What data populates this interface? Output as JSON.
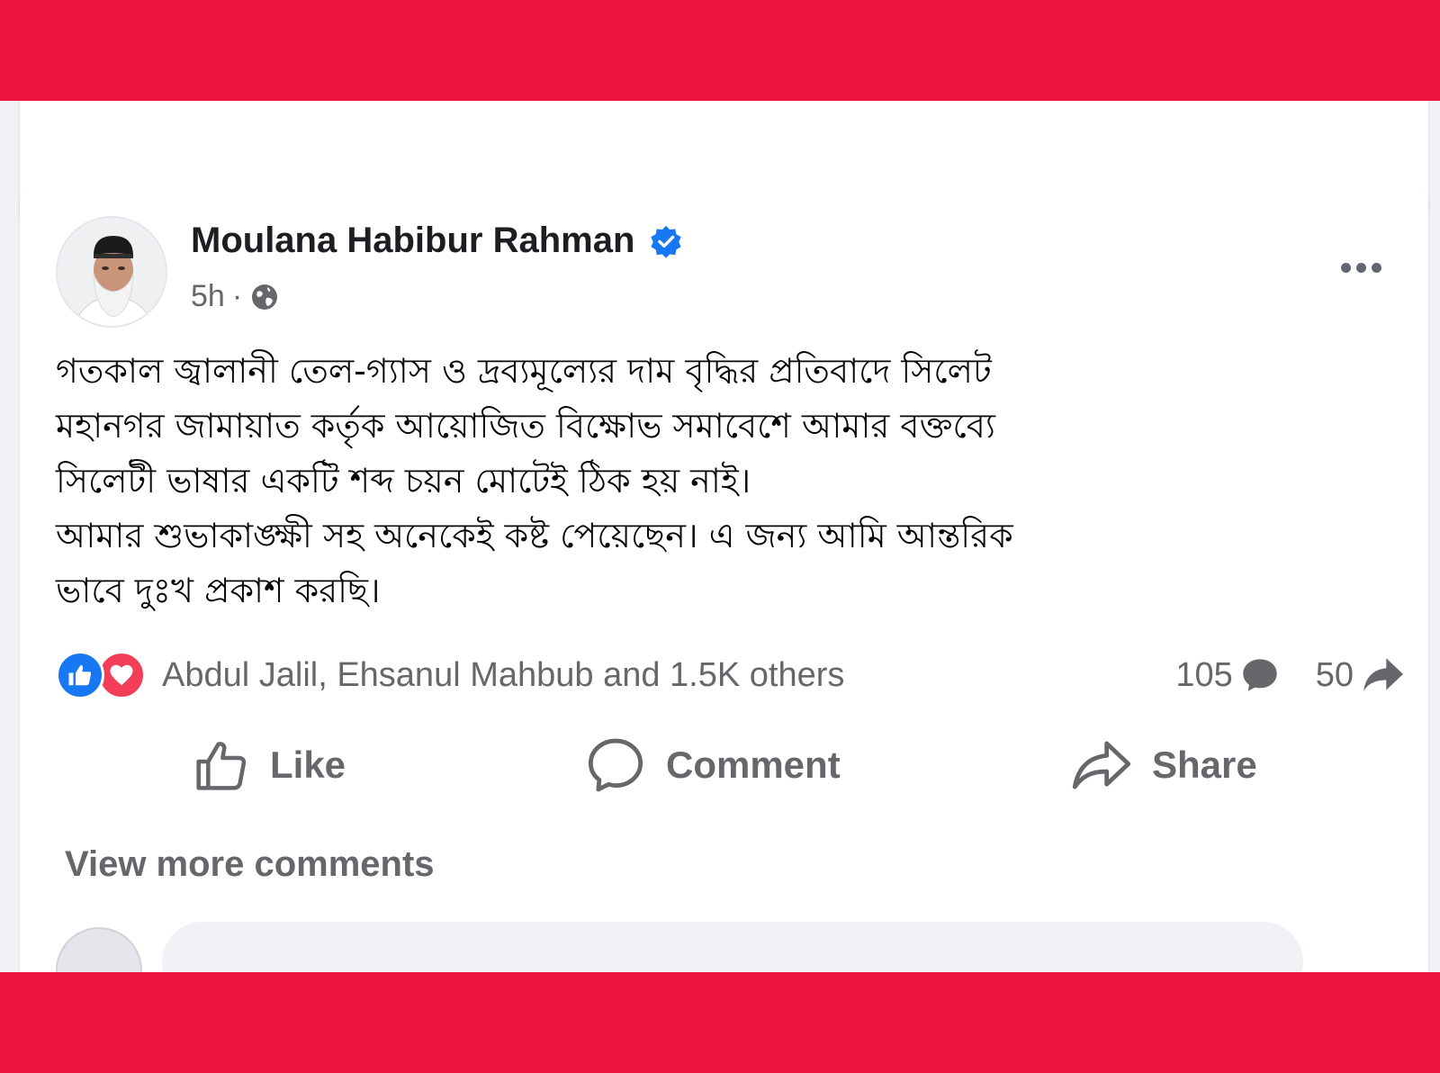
{
  "post": {
    "author": "Moulana Habibur Rahman",
    "time": "5h",
    "separator": "·",
    "body_lines": [
      "গতকাল জ্বালানী তেল-গ্যাস ও দ্রব্যমূল্যের দাম বৃদ্ধির প্রতিবাদে সিলেট",
      "মহানগর জামায়াত কর্তৃক আয়োজিত বিক্ষোভ সমাবেশে আমার বক্তব্যে",
      "সিলেটী ভাষার একটি শব্দ চয়ন মোটেই ঠিক হয় নাই।",
      "আমার শুভাকাঙ্ক্ষী সহ অনেকেই কষ্ট পেয়েছেন। এ জন্য আমি আন্তরিক",
      "ভাবে দুঃখ প্রকাশ করছি।"
    ],
    "reactions_text": "Abdul Jalil, Ehsanul Mahbub and 1.5K others",
    "comment_count": "105",
    "share_count": "50"
  },
  "actions": {
    "like": "Like",
    "comment": "Comment",
    "share": "Share"
  },
  "comments": {
    "view_more": "View more comments"
  },
  "colors": {
    "brand_band": "#ee1440",
    "facebook_blue": "#1877f2",
    "love_red": "#f33e58",
    "secondary_text": "#65676b",
    "feed_background": "#f0f2f5"
  },
  "icons": [
    "verified-badge-icon",
    "globe-icon",
    "more-options-icon",
    "like-reaction-icon",
    "love-reaction-icon",
    "comment-bubble-icon",
    "share-arrow-icon",
    "thumbs-up-icon",
    "comment-icon",
    "share-icon"
  ]
}
